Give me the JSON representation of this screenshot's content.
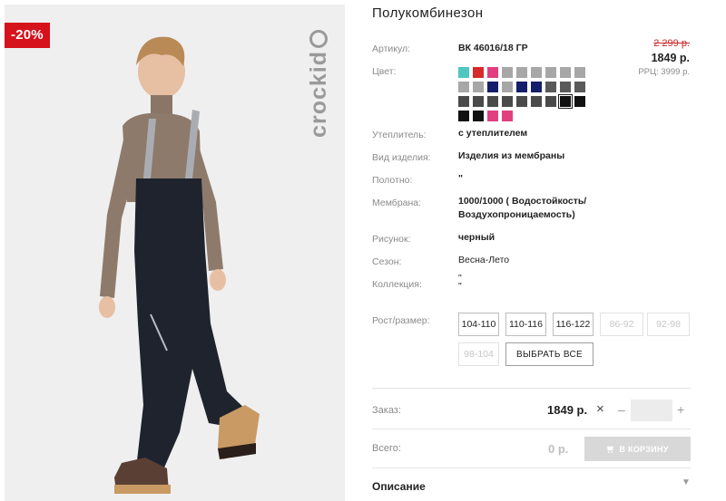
{
  "badge": {
    "discount": "-20%"
  },
  "brand": {
    "logo_text": "crockid"
  },
  "product": {
    "title": "Полукомбинезон",
    "price_old": "2 299 р.",
    "price_new": "1849 р.",
    "price_rrp": "РРЦ: 3999 р."
  },
  "specs": [
    {
      "label": "Артикул:",
      "value": "ВК 46016/18 ГР"
    },
    {
      "label": "Цвет:",
      "value": ""
    },
    {
      "label": "Утеплитель:",
      "value": "с утеплителем"
    },
    {
      "label": "Вид изделия:",
      "value": "Изделия из мембраны"
    },
    {
      "label": "Полотно:",
      "value": "\""
    },
    {
      "label": "Мембрана:",
      "value": "1000/1000 ( Водостойкость/ Воздухопроницаемость)"
    },
    {
      "label": "Рисунок:",
      "value": "черный"
    },
    {
      "label": "Сезон:",
      "value": "Весна-Лето"
    },
    {
      "label": "Коллекция:",
      "value": "\"\n\""
    }
  ],
  "colors": [
    "#4fc7c0",
    "#d62b2b",
    "#e0407f",
    "#a7a7a7",
    "#a7a7a7",
    "#a7a7a7",
    "#a7a7a7",
    "#a7a7a7",
    "#a7a7a7",
    "#a7a7a7",
    "#a7a7a7",
    "#141e6b",
    "#a7a7a7",
    "#141e6b",
    "#141e6b",
    "#5a5a5a",
    "#5a5a5a",
    "#5a5a5a",
    "#4a4a4a",
    "#4a4a4a",
    "#4a4a4a",
    "#4a4a4a",
    "#4a4a4a",
    "#4a4a4a",
    "#4a4a4a",
    "#111111",
    "#111111",
    "#111111",
    "#111111",
    "#e0407f",
    "#e0407f"
  ],
  "selected_color_index": 25,
  "sizes": {
    "label": "Рост/размер:",
    "options": [
      {
        "label": "104-110",
        "available": true
      },
      {
        "label": "110-116",
        "available": true
      },
      {
        "label": "116-122",
        "available": true
      },
      {
        "label": "86-92",
        "available": false
      },
      {
        "label": "92-98",
        "available": false
      },
      {
        "label": "98-104",
        "available": false
      }
    ],
    "select_all": "ВЫБРАТЬ ВСЕ"
  },
  "order": {
    "label": "Заказ:",
    "price": "1849 р.",
    "times": "×",
    "minus": "–",
    "plus": "+",
    "quantity": ""
  },
  "total": {
    "label": "Всего:",
    "value": "0 р.",
    "cart_button": "В КОРЗИНУ"
  },
  "description": {
    "label": "Описание"
  },
  "palette": {
    "discount_red": "#d6121c",
    "old_price_red": "#c8262a",
    "disabled_button": "#d8d8d8"
  }
}
